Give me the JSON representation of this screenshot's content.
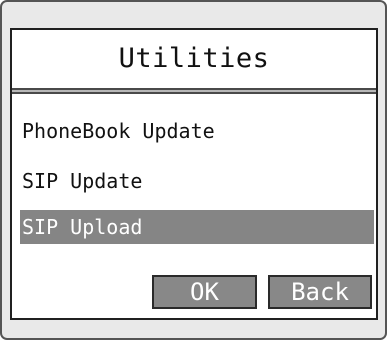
{
  "screen": {
    "title": "Utilities"
  },
  "menu": {
    "items": [
      {
        "label": "PhoneBook Update",
        "selected": false
      },
      {
        "label": "SIP Update",
        "selected": false
      },
      {
        "label": "SIP Upload",
        "selected": true
      }
    ]
  },
  "buttons": {
    "ok_label": "OK",
    "back_label": "Back"
  },
  "colors": {
    "selection_bg": "#858585",
    "button_bg": "#888888",
    "device_bg": "#e9e9e9"
  }
}
